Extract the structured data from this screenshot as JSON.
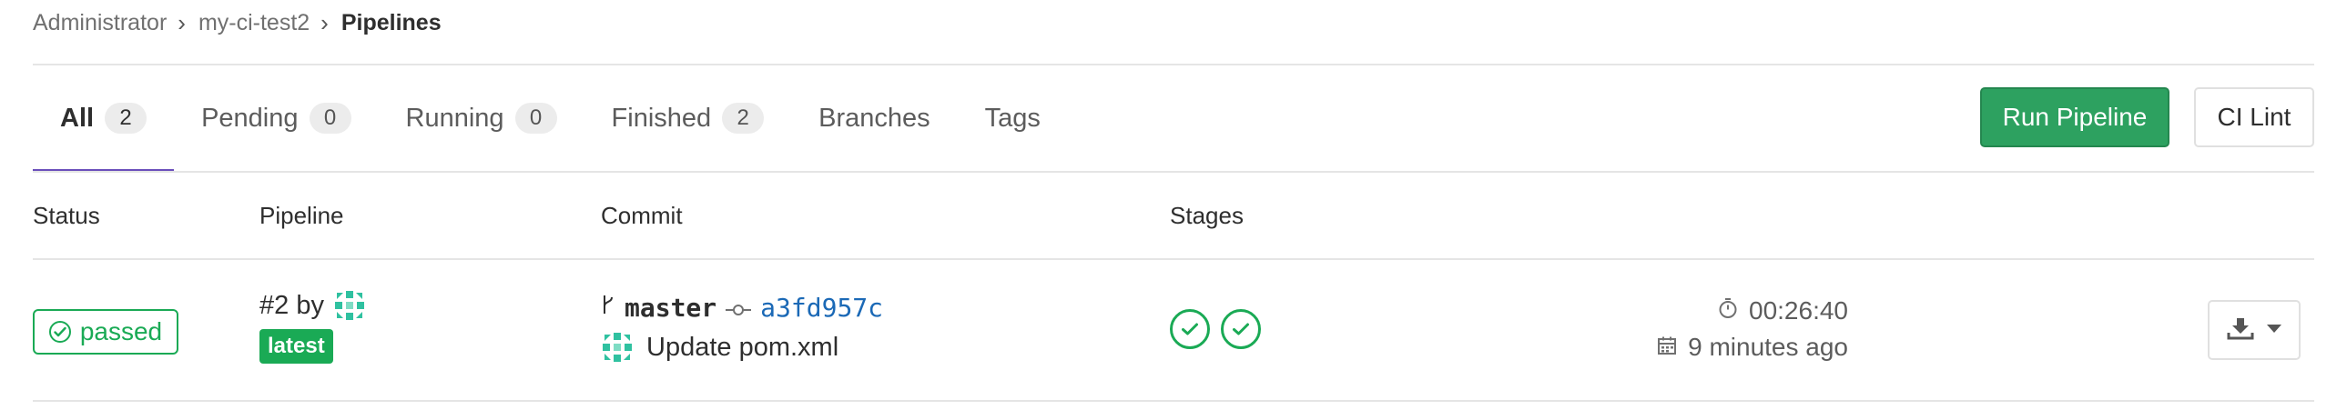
{
  "breadcrumb": {
    "items": [
      "Administrator",
      "my-ci-test2",
      "Pipelines"
    ]
  },
  "tabs": [
    {
      "label": "All",
      "count": "2",
      "active": true
    },
    {
      "label": "Pending",
      "count": "0"
    },
    {
      "label": "Running",
      "count": "0"
    },
    {
      "label": "Finished",
      "count": "2"
    },
    {
      "label": "Branches"
    },
    {
      "label": "Tags"
    }
  ],
  "actions": {
    "run_pipeline": "Run Pipeline",
    "ci_lint": "CI Lint"
  },
  "table": {
    "headers": {
      "status": "Status",
      "pipeline": "Pipeline",
      "commit": "Commit",
      "stages": "Stages"
    },
    "rows": [
      {
        "status": "passed",
        "pipeline_id": "#2 by",
        "badge": "latest",
        "branch": "master",
        "sha": "a3fd957c",
        "message": "Update pom.xml",
        "duration": "00:26:40",
        "finished": "9 minutes ago",
        "stages": [
          "passed",
          "passed"
        ]
      }
    ]
  },
  "colors": {
    "success": "#1aaa55",
    "run_button": "#2da160",
    "tab_underline": "#6b4fbb",
    "sha_link": "#1b69b6"
  },
  "icons": [
    "chevron-right-icon",
    "check-circle-icon",
    "avatar-identicon",
    "branch-icon",
    "commit-icon",
    "timer-icon",
    "calendar-icon",
    "download-icon",
    "caret-down-icon"
  ]
}
